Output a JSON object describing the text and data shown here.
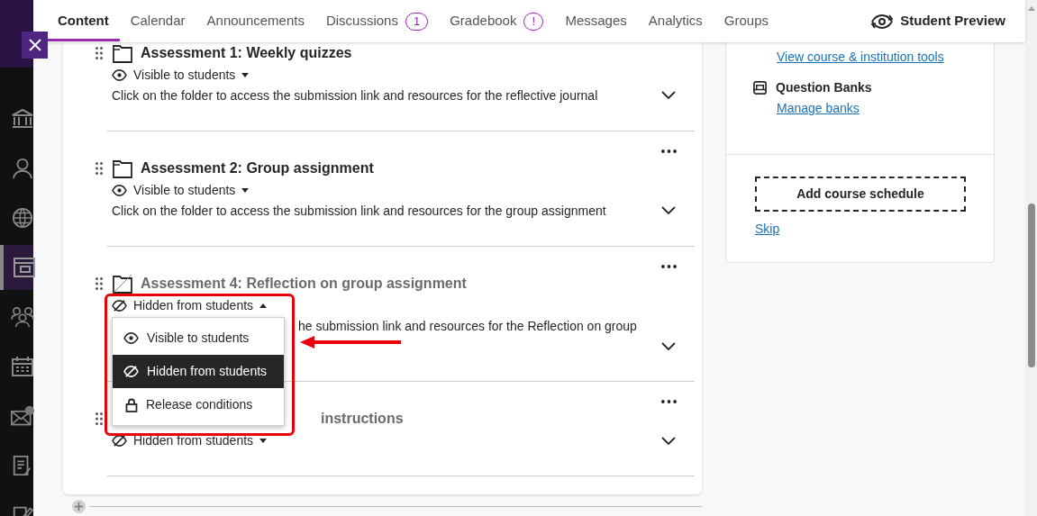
{
  "sidebar": {
    "items": [
      {
        "kind": "institution",
        "selected": false
      },
      {
        "kind": "person",
        "selected": false
      },
      {
        "kind": "globe",
        "selected": false
      },
      {
        "kind": "course",
        "selected": true
      },
      {
        "kind": "groups",
        "selected": false
      },
      {
        "kind": "calendar",
        "selected": false
      },
      {
        "kind": "mail",
        "selected": false
      },
      {
        "kind": "grades",
        "selected": false
      },
      {
        "kind": "edit",
        "selected": false
      }
    ]
  },
  "tabs": [
    {
      "label": "Content",
      "selected": true
    },
    {
      "label": "Calendar",
      "selected": false
    },
    {
      "label": "Announcements",
      "selected": false
    },
    {
      "label": "Discussions",
      "selected": false,
      "badge": "1"
    },
    {
      "label": "Gradebook",
      "selected": false,
      "badge": "!"
    },
    {
      "label": "Messages",
      "selected": false
    },
    {
      "label": "Analytics",
      "selected": false
    },
    {
      "label": "Groups",
      "selected": false
    }
  ],
  "student_preview": {
    "label": "Student Preview"
  },
  "content_items": [
    {
      "title": "Assessment 1: Weekly quizzes",
      "hidden": false,
      "visibility": {
        "label": "Visible to students",
        "menu_open": false
      },
      "description": "Click on the folder to access the submission link and resources for the reflective journal"
    },
    {
      "title": "Assessment 2: Group assignment",
      "hidden": false,
      "visibility": {
        "label": "Visible to students",
        "menu_open": false
      },
      "description": "Click on the folder to access the submission link and resources for the group assignment"
    },
    {
      "title": "Assessment 4: Reflection on group assignment",
      "hidden": true,
      "visibility": {
        "label": "Hidden from students",
        "menu_open": true
      },
      "description": "he submission link and resources for the Reflection on group"
    },
    {
      "title": "instructions",
      "hidden": true,
      "visibility": {
        "label": "Hidden from students",
        "menu_open": false
      }
    }
  ],
  "visibility_menu": {
    "items": [
      {
        "kind": "eye",
        "label": "Visible to students",
        "selected": false
      },
      {
        "kind": "eye-off",
        "label": "Hidden from students",
        "selected": true
      },
      {
        "kind": "lock",
        "label": "Release conditions",
        "selected": false
      }
    ]
  },
  "right_panel": {
    "tools_link": "View course & institution tools",
    "question_banks": {
      "title": "Question Banks",
      "link": "Manage banks"
    },
    "schedule_button": "Add course schedule",
    "skip_link": "Skip"
  }
}
